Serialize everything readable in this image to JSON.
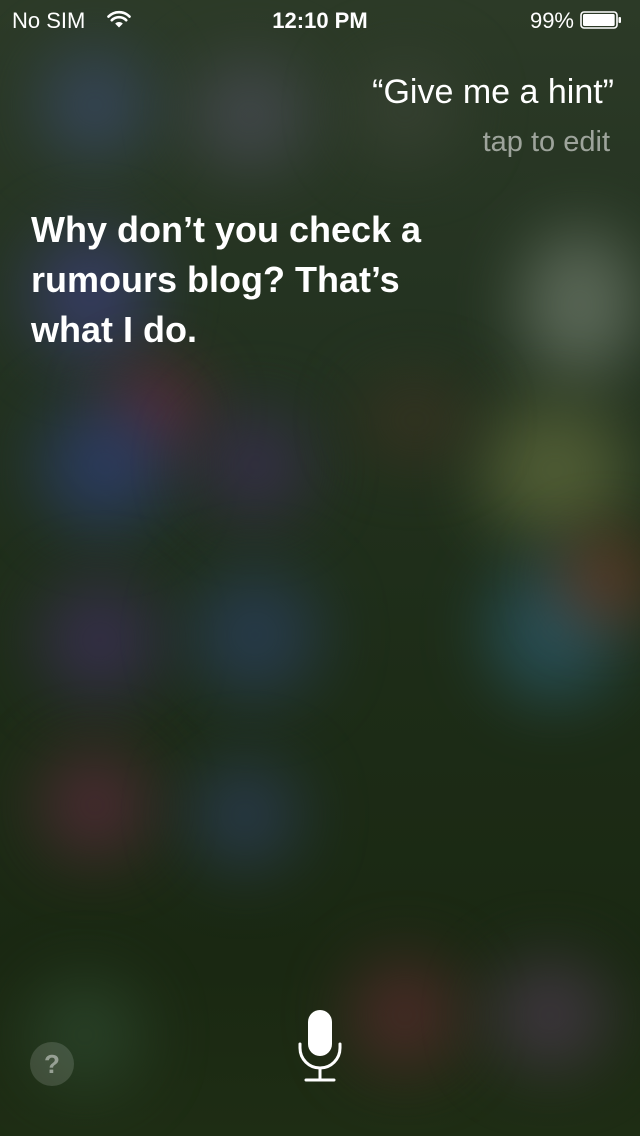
{
  "status_bar": {
    "carrier": "No SIM",
    "time": "12:10 PM",
    "battery_percent": "99%",
    "battery_level": 0.99,
    "wifi_icon": "wifi-icon",
    "battery_icon": "battery-icon"
  },
  "siri": {
    "query": "“Give me a hint”",
    "edit_hint": "tap to edit",
    "response": "Why don’t you check a rumours blog? That’s what I do.",
    "help_label": "?",
    "help_icon": "question-mark-icon",
    "mic_icon": "microphone-icon"
  },
  "colors": {
    "text_primary": "#ffffff",
    "text_secondary": "rgba(255,255,255,0.55)",
    "backdrop": "#1e2a18"
  }
}
